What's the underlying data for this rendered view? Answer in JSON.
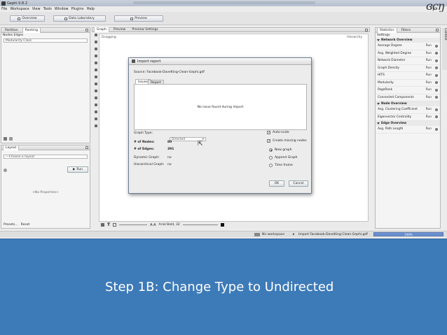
{
  "window": {
    "title": "Gephi 0.8.2"
  },
  "menu": [
    "File",
    "Workspace",
    "View",
    "Tools",
    "Window",
    "Plugins",
    "Help"
  ],
  "toolbar": {
    "overview": "Overview",
    "data_lab": "Data Laboratory",
    "preview": "Preview"
  },
  "left_panel": {
    "tabs": [
      "Partition",
      "Ranking"
    ],
    "subtabs": "Nodes Edges",
    "select_value": "Modularity Class",
    "layout_tab": "Layout",
    "layout_select": "---Choose a layout",
    "run_label": "Run",
    "no_props": "<No Properties>",
    "presets": "Presets...",
    "reset": "Reset"
  },
  "graph_panel": {
    "tabs": [
      "Graph",
      "Preview",
      "Preview Settings"
    ],
    "dragging": "Dragging",
    "hierarchy": "Hierarchy",
    "font_label": "Arial Bold, 32"
  },
  "statusbar": {
    "workspace": "Nir workspace",
    "import_label": "Import Facebook-DaveKing-Clean-Gephi.gdf",
    "progress": "100%"
  },
  "right_panel": {
    "tabs": [
      "Statistics",
      "Filters"
    ],
    "settings": "Settings",
    "context": "Context",
    "sections": [
      {
        "header": "Network Overview",
        "rows": [
          "Average Degree",
          "Avg. Weighted Degree",
          "Network Diameter",
          "Graph Density",
          "HITS",
          "Modularity",
          "PageRank",
          "Connected Components"
        ]
      },
      {
        "header": "Node Overview",
        "rows": [
          "Avg. Clustering Coefficient",
          "Eigenvector Centrality"
        ]
      },
      {
        "header": "Edge Overview",
        "rows": [
          "Avg. Path Length"
        ]
      }
    ],
    "run_label": "Run"
  },
  "dialog": {
    "title": "Import report",
    "source": "Source: Facebook-DaveKing-Clean-Gephi.gdf",
    "tabs": [
      "Issues",
      "Report"
    ],
    "no_issue": "No issue found during import",
    "graph_type_label": "Graph Type:",
    "graph_type_value": "Directed",
    "nodes_label": "# of Nodes:",
    "nodes_value": "80",
    "edges_label": "# of Edges:",
    "edges_value": "391",
    "dynamic_label": "Dynamic Graph:",
    "dynamic_value": "no",
    "hier_label": "Hierarchical Graph:",
    "hier_value": "no",
    "auto_scale": "Auto-scale",
    "create_missing": "Create missing nodes",
    "radio_new": "New graph",
    "radio_append": "Append Graph",
    "radio_time": "Time frame",
    "ok": "OK",
    "cancel": "Cancel"
  },
  "slide": {
    "caption": "Step 1B: Change Type to Undirected"
  }
}
